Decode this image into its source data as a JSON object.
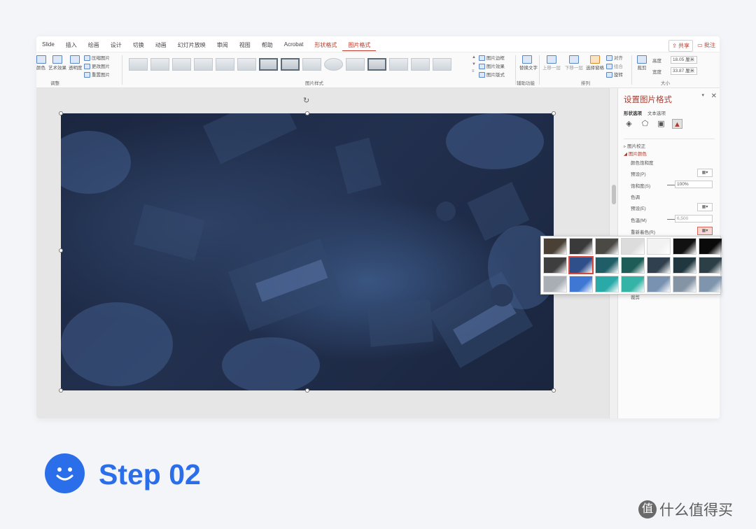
{
  "menu": {
    "tabs": [
      "Slide",
      "插入",
      "绘画",
      "设计",
      "切换",
      "动画",
      "幻灯片放映",
      "审阅",
      "视图",
      "帮助",
      "Acrobat",
      "形状格式",
      "图片格式"
    ],
    "context_tab": "形状格式",
    "active_tab": "图片格式",
    "share_label": "共享",
    "comment_label": "批注"
  },
  "ribbon": {
    "adjust_items": [
      "颜色",
      "艺术效果",
      "透明度"
    ],
    "adjust_small": [
      "压缩图片",
      "更改图片",
      "重置图片"
    ],
    "adjust_group": "调整",
    "styles_group": "图片样式",
    "style_right": [
      "图片边框",
      "图片效果",
      "图片版式"
    ],
    "alt_text": "替换文字",
    "accessibility_group": "辅助功能",
    "arrange_items": [
      "上移一层",
      "下移一层",
      "选择窗格"
    ],
    "arrange_small": [
      "对齐",
      "组合",
      "旋转"
    ],
    "arrange_group": "排列",
    "crop_label": "裁剪",
    "height_label": "高度",
    "height_value": "18.05 厘米",
    "width_label": "宽度",
    "width_value": "33.87 厘米",
    "size_group": "大小"
  },
  "panel": {
    "title": "设置图片格式",
    "tabs": [
      "形状选项",
      "文本选项"
    ],
    "section_correction": "图片校正",
    "section_color": "图片颜色",
    "saturation_heading": "颜色饱和度",
    "preset_label": "预设(P)",
    "saturation_label": "饱和度(S)",
    "saturation_value": "100%",
    "tone_heading": "色调",
    "preset2_label": "预设(E)",
    "temperature_label": "色温(M)",
    "temperature_value": "6,500",
    "recolor_label": "重新着色(R)",
    "collapsed_label": "裁剪"
  },
  "recolor": {
    "selected_index": 8,
    "swatches": [
      "#4a4035",
      "#3a3a3a",
      "#4b4944",
      "#dcdcdc",
      "#f2f2f2",
      "#111111",
      "#0a0a0a",
      "#3e3e3e",
      "#2f4f8a",
      "#1f5e66",
      "#1d5c57",
      "#30404e",
      "#20373f",
      "#2c3e46",
      "#a8aeb4",
      "#3f78d4",
      "#2aa9a9",
      "#34b3a6",
      "#7a92b2",
      "#8494a5",
      "#7f95ad"
    ]
  },
  "footer": {
    "step_label": "Step 02",
    "watermark_badge": "值",
    "watermark_text": "什么值得买"
  }
}
